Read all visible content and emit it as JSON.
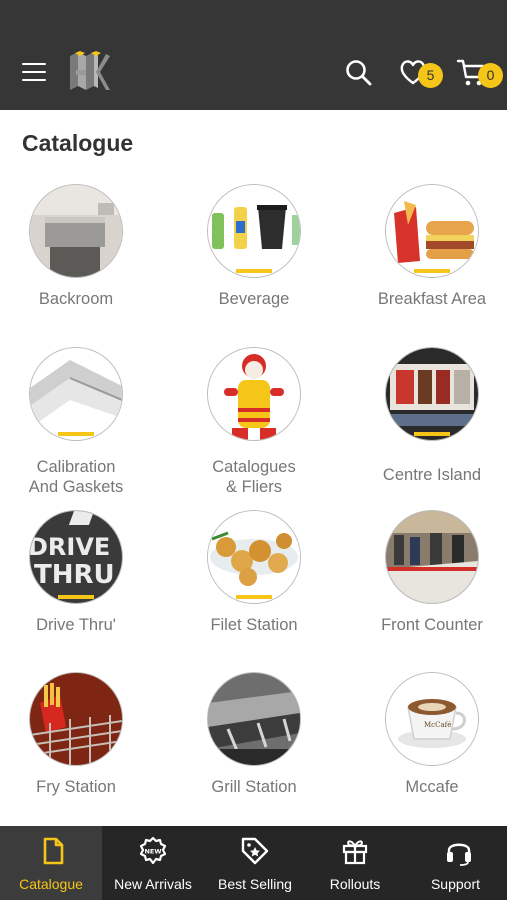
{
  "header": {
    "brand": "HK",
    "wishlist_count": "5",
    "cart_count": "0",
    "accent_color": "#f5c518",
    "bar_color": "#363636"
  },
  "catalogue": {
    "title": "Catalogue",
    "items": [
      {
        "label": "Backroom",
        "icon": "backroom-photo"
      },
      {
        "label": "Beverage",
        "icon": "beverage-photo"
      },
      {
        "label": "Breakfast Area",
        "icon": "breakfast-photo"
      },
      {
        "label": "Calibration And Gaskets",
        "line1": "Calibration",
        "line2": "And Gaskets",
        "icon": "gaskets-photo"
      },
      {
        "label": "Catalogues & Fliers",
        "line1": "Catalogues",
        "line2": "& Fliers",
        "icon": "mascot-photo"
      },
      {
        "label": "Centre Island",
        "icon": "centre-island-photo"
      },
      {
        "label": "Drive Thru'",
        "icon": "drive-thru-photo"
      },
      {
        "label": "Filet Station",
        "icon": "filet-photo"
      },
      {
        "label": "Front Counter",
        "icon": "front-counter-photo"
      },
      {
        "label": "Fry Station",
        "icon": "fries-photo"
      },
      {
        "label": "Grill Station",
        "icon": "grill-photo"
      },
      {
        "label": "Mccafe",
        "icon": "mccafe-photo"
      }
    ]
  },
  "bottom_nav": [
    {
      "label": "Catalogue",
      "icon": "document-icon",
      "active": true
    },
    {
      "label": "New Arrivals",
      "icon": "new-badge-icon",
      "active": false
    },
    {
      "label": "Best Selling",
      "icon": "tag-star-icon",
      "active": false
    },
    {
      "label": "Rollouts",
      "icon": "gift-icon",
      "active": false
    },
    {
      "label": "Support",
      "icon": "headset-icon",
      "active": false
    }
  ]
}
